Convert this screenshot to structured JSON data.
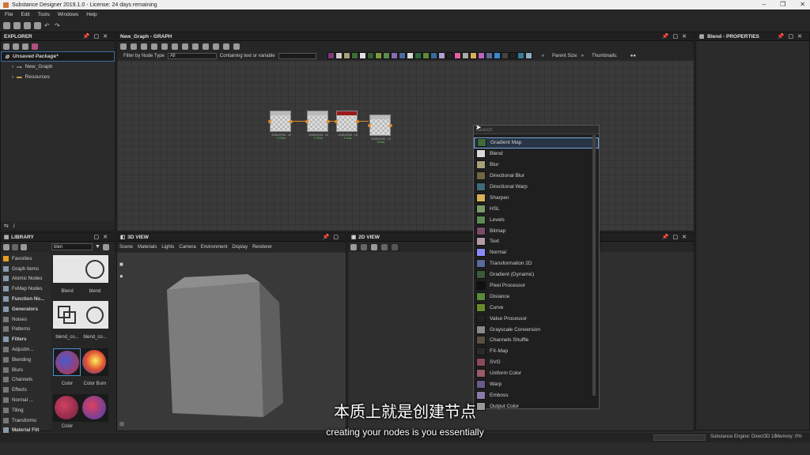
{
  "app": {
    "title": "Substance Designer 2019.1.0 - License: 24 days remaining",
    "window_controls": [
      "–",
      "❐",
      "✕"
    ]
  },
  "menu": [
    "File",
    "Edit",
    "Tools",
    "Windows",
    "Help"
  ],
  "explorer": {
    "title": "EXPLORER",
    "package": "Unsaved Package*",
    "graph": "New_Graph",
    "resources": "Resources"
  },
  "graph_panel": {
    "title": "New_Graph - GRAPH",
    "filter_label": "Filter by Node Type",
    "filter_value": "All",
    "containing_label": "Containing text or variable",
    "parent_size": "Parent Size:",
    "thumbnails": "Thumbnails:"
  },
  "nodes": [
    {
      "label": "Blend",
      "size": "2048x2048 - L8",
      "time": "1.23ms"
    },
    {
      "label": "Blend",
      "size": "2048x2048 - L8",
      "time": "1.37ms"
    },
    {
      "label": "Blend",
      "size": "2048x2048 - L8",
      "time": "2.1ms"
    },
    {
      "label": "Blend",
      "size": "2048x2048 - L8",
      "time": "0.9ms"
    }
  ],
  "node_menu": {
    "search_placeholder": "Search",
    "items": [
      {
        "label": "Gradient Map",
        "color": "#3f6b3a"
      },
      {
        "label": "Blend",
        "color": "#d8d8d8"
      },
      {
        "label": "Blur",
        "color": "#a8a07a"
      },
      {
        "label": "Directional Blur",
        "color": "#6e6644"
      },
      {
        "label": "Directional Warp",
        "color": "#3f6a7a"
      },
      {
        "label": "Sharpen",
        "color": "#d8b05a"
      },
      {
        "label": "HSL",
        "color": "#7a9a6a"
      },
      {
        "label": "Levels",
        "color": "#5d8a52"
      },
      {
        "label": "Bitmap",
        "color": "#7a4a6a"
      },
      {
        "label": "Text",
        "color": "#b49aa8"
      },
      {
        "label": "Normal",
        "color": "#8a8aff"
      },
      {
        "label": "Transformation 2D",
        "color": "#5a6a9a"
      },
      {
        "label": "Gradient (Dynamic)",
        "color": "#3a5a3a"
      },
      {
        "label": "Pixel Processor",
        "color": "#111111"
      },
      {
        "label": "Distance",
        "color": "#5a8a3a"
      },
      {
        "label": "Curve",
        "color": "#6a8a2a"
      },
      {
        "label": "Value Processor",
        "color": "#222222"
      },
      {
        "label": "Grayscale Conversion",
        "color": "#8a8a8a"
      },
      {
        "label": "Channels Shuffle",
        "color": "#5a5040"
      },
      {
        "label": "FX-Map",
        "color": "#2a2a2a"
      },
      {
        "label": "SVG",
        "color": "#8a4a5a"
      },
      {
        "label": "Uniform Color",
        "color": "#9a5a6a"
      },
      {
        "label": "Warp",
        "color": "#6a5a8a"
      },
      {
        "label": "Emboss",
        "color": "#8a7aa8"
      },
      {
        "label": "Output Color",
        "color": "#999999"
      }
    ]
  },
  "properties": {
    "title": "Blend - PROPERTIES"
  },
  "library": {
    "title": "LIBRARY",
    "search_value": "blen",
    "categories": [
      {
        "label": "Favorites",
        "color": "#e0a020",
        "bold": false
      },
      {
        "label": "Graph Items",
        "color": "#8899aa",
        "bold": false
      },
      {
        "label": "Atomic Nodes",
        "color": "#8899aa",
        "bold": false
      },
      {
        "label": "FxMap Nodes",
        "color": "#8899aa",
        "bold": false
      },
      {
        "label": "Function No...",
        "color": "#8899aa",
        "bold": true
      },
      {
        "label": "Generators",
        "color": "#8899aa",
        "bold": true
      },
      {
        "label": "Noises",
        "color": "#777777",
        "bold": false
      },
      {
        "label": "Patterns",
        "color": "#777777",
        "bold": false
      },
      {
        "label": "Filters",
        "color": "#8899aa",
        "bold": true
      },
      {
        "label": "Adjustm...",
        "color": "#777777",
        "bold": false
      },
      {
        "label": "Blending",
        "color": "#777777",
        "bold": false
      },
      {
        "label": "Blurs",
        "color": "#777777",
        "bold": false
      },
      {
        "label": "Channels",
        "color": "#777777",
        "bold": false
      },
      {
        "label": "Effects",
        "color": "#777777",
        "bold": false
      },
      {
        "label": "Normal ...",
        "color": "#777777",
        "bold": false
      },
      {
        "label": "Tiling",
        "color": "#777777",
        "bold": false
      },
      {
        "label": "Transforms",
        "color": "#777777",
        "bold": false
      },
      {
        "label": "Material Filt",
        "color": "#8899aa",
        "bold": true
      }
    ],
    "thumbs": [
      "Blend",
      "blend",
      "blend_co...",
      "blend_co...",
      "Color",
      "Color Burn",
      "Color",
      ""
    ]
  },
  "view3d": {
    "title": "3D VIEW",
    "menu": [
      "Scene",
      "Materials",
      "Lights",
      "Camera",
      "Environment",
      "Display",
      "Renderer"
    ]
  },
  "view2d": {
    "title": "2D VIEW"
  },
  "status": {
    "engine": "Substance Engine: Direct3D 10",
    "memory": "Memory: 0%"
  },
  "subtitles": {
    "zh": "本质上就是创建节点",
    "en": "creating your nodes is you essentially"
  }
}
